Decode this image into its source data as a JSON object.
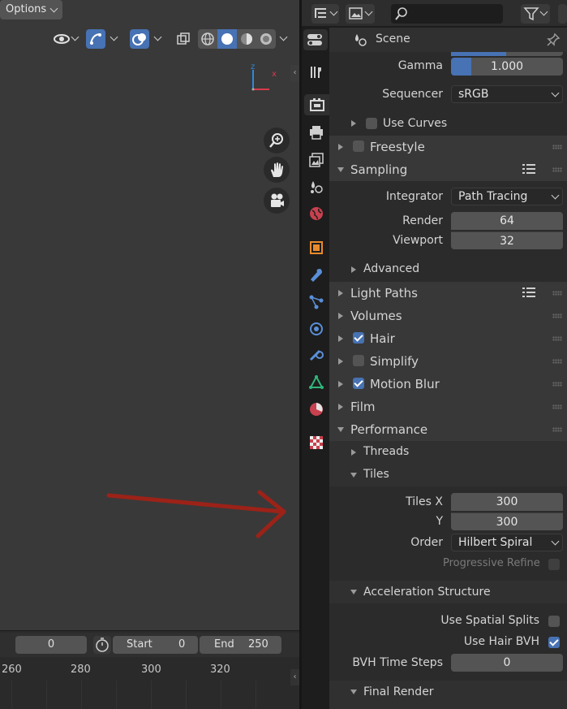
{
  "viewport": {
    "options_label": "Options",
    "axis_labels": {
      "z": "z",
      "x": "x"
    },
    "icons": [
      "visibility-icon",
      "gizmo-icon",
      "overlay-icon",
      "xray-icon",
      "wireframe-shading-icon",
      "solid-shading-icon",
      "material-shading-icon",
      "rendered-shading-icon",
      "zoom-icon",
      "pan-hand-icon",
      "camera-view-icon"
    ]
  },
  "timeline": {
    "current_frame": "0",
    "start_label": "Start",
    "start_value": "0",
    "end_label": "End",
    "end_value": "250",
    "ruler_ticks": [
      "260",
      "280",
      "300",
      "320"
    ]
  },
  "props_header": {
    "breadcrumb": "Scene",
    "search_placeholder": ""
  },
  "color_management": {
    "gamma_label": "Gamma",
    "gamma_value": "1.000",
    "gamma_fill_fraction": 0.18,
    "sequencer_label": "Sequencer",
    "sequencer_value": "sRGB",
    "use_curves_label": "Use Curves"
  },
  "panels": {
    "freestyle": "Freestyle",
    "sampling": "Sampling",
    "integrator_label": "Integrator",
    "integrator_value": "Path Tracing",
    "render_label": "Render",
    "render_value": "64",
    "viewport_label": "Viewport",
    "viewport_value": "32",
    "advanced": "Advanced",
    "light_paths": "Light Paths",
    "volumes": "Volumes",
    "hair": "Hair",
    "simplify": "Simplify",
    "motion_blur": "Motion Blur",
    "film": "Film",
    "performance": "Performance",
    "threads": "Threads",
    "tiles": "Tiles",
    "tiles_x_label": "Tiles X",
    "tiles_x_value": "300",
    "tiles_y_label": "Y",
    "tiles_y_value": "300",
    "order_label": "Order",
    "order_value": "Hilbert Spiral",
    "progressive_refine": "Progressive Refine",
    "acceleration_structure": "Acceleration Structure",
    "use_spatial_splits": "Use Spatial Splits",
    "use_hair_bvh": "Use Hair BVH",
    "bvh_time_steps_label": "BVH Time Steps",
    "bvh_time_steps_value": "0",
    "final_render": "Final Render"
  },
  "checkbox_states": {
    "use_curves": false,
    "freestyle": false,
    "hair": true,
    "simplify": false,
    "motion_blur": true,
    "progressive_refine": false,
    "use_spatial_splits": false,
    "use_hair_bvh": true
  },
  "tabs": [
    "tool-icon",
    "render-icon",
    "output-icon",
    "view-layer-icon",
    "scene-icon",
    "world-icon",
    "object-icon",
    "modifier-icon",
    "particles-icon",
    "physics-icon",
    "constraints-icon",
    "data-icon",
    "material-icon",
    "texture-icon"
  ],
  "colors": {
    "accent_blue": "#4772b3",
    "annotation_arrow": "#9c2218",
    "axis_z": "#2f88d8",
    "axis_x": "#d93a4b"
  }
}
